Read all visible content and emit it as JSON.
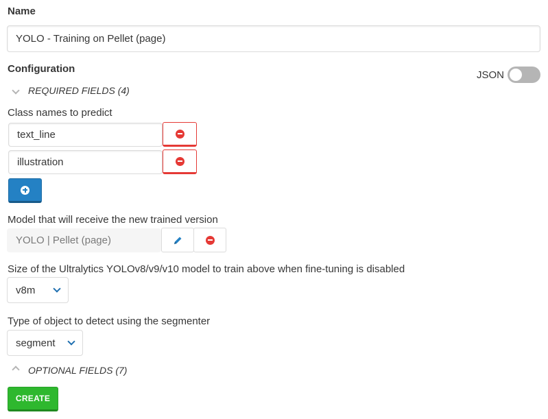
{
  "name_section": {
    "label": "Name",
    "value": "YOLO - Training on Pellet (page)"
  },
  "configuration": {
    "label": "Configuration",
    "json_label": "JSON",
    "json_toggle_on": false
  },
  "required_fields": {
    "label": "REQUIRED FIELDS (4)"
  },
  "class_names": {
    "label": "Class names to predict",
    "items": [
      "text_line",
      "illustration"
    ]
  },
  "model": {
    "label": "Model that will receive the new trained version",
    "value": "YOLO | Pellet (page)"
  },
  "size": {
    "label": "Size of the Ultralytics YOLOv8/v9/v10 model to train above when fine-tuning is disabled",
    "selected": "v8m"
  },
  "object_type": {
    "label": "Type of object to detect using the segmenter",
    "selected": "segment"
  },
  "optional_fields": {
    "label": "OPTIONAL FIELDS (7)"
  },
  "actions": {
    "create_label": "CREATE"
  },
  "colors": {
    "primary": "#2481c4",
    "danger": "#e53935",
    "success": "#2eb82e"
  }
}
